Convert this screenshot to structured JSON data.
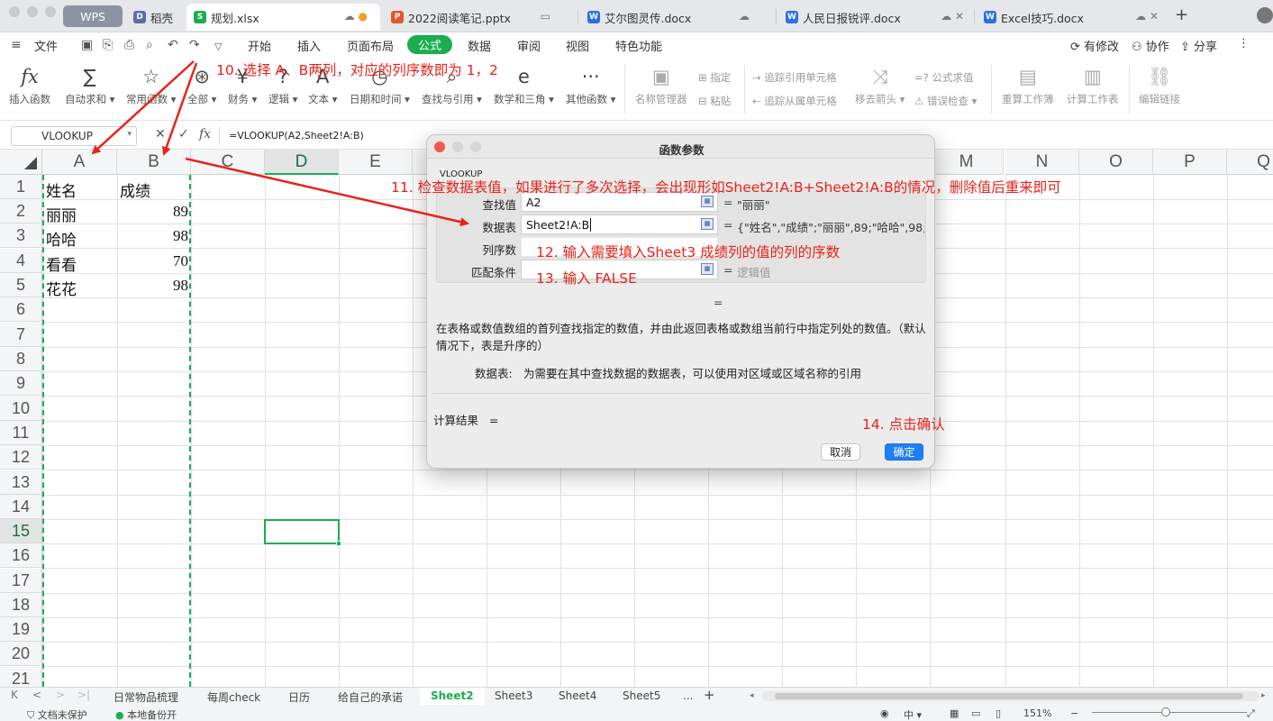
{
  "tabs": [
    {
      "label": "WPS",
      "icon": "wps-home-icon"
    },
    {
      "label": "稻壳",
      "icon": "docer-icon"
    },
    {
      "label": "规划.xlsx",
      "icon": "spreadsheet-s-icon",
      "active": true
    },
    {
      "label": "2022阅读笔记.pptx",
      "icon": "presentation-p-icon"
    },
    {
      "label": "艾尔图灵传.docx",
      "icon": "document-w-icon"
    },
    {
      "label": "人民日报锐评.docx",
      "icon": "document-w-icon"
    },
    {
      "label": "Excel技巧.docx",
      "icon": "document-w-icon"
    }
  ],
  "menubar": {
    "file_label": "文件",
    "items": [
      "开始",
      "插入",
      "页面布局",
      "公式",
      "数据",
      "审阅",
      "视图",
      "特色功能"
    ],
    "active_item": "公式",
    "right": [
      "有修改",
      "协作",
      "分享"
    ]
  },
  "ribbon": {
    "buttons": [
      {
        "icon": "fx-icon",
        "glyph": "fx",
        "label": "插入函数"
      },
      {
        "icon": "sigma-icon",
        "glyph": "∑",
        "label": "自动求和"
      },
      {
        "icon": "star-icon",
        "glyph": "☆",
        "label": "常用函数"
      },
      {
        "icon": "all-functions-icon",
        "glyph": "⊛",
        "label": "全部"
      },
      {
        "icon": "finance-icon",
        "glyph": "¥",
        "label": "财务"
      },
      {
        "icon": "logic-icon",
        "glyph": "?",
        "label": "逻辑"
      },
      {
        "icon": "text-icon",
        "glyph": "A",
        "label": "文本"
      },
      {
        "icon": "datetime-icon",
        "glyph": "◷",
        "label": "日期和时间"
      },
      {
        "icon": "lookup-icon",
        "glyph": "⌕",
        "label": "查找与引用"
      },
      {
        "icon": "math-icon",
        "glyph": "e",
        "label": "数学和三角"
      },
      {
        "icon": "more-functions-icon",
        "glyph": "···",
        "label": "其他函数"
      },
      {
        "icon": "name-manager-icon",
        "glyph": "▣",
        "label": "名称管理器"
      },
      {
        "icon": "remove-arrows-icon",
        "glyph": "⤨",
        "label": "移去箭头"
      },
      {
        "icon": "recalc-workbook-icon",
        "glyph": "▤",
        "label": "重算工作簿"
      },
      {
        "icon": "calc-sheet-icon",
        "glyph": "▥",
        "label": "计算工作表"
      },
      {
        "icon": "edit-links-icon",
        "glyph": "⛓",
        "label": "编辑链接"
      }
    ],
    "small": [
      "指定",
      "粘贴",
      "追踪引用单元格",
      "追踪从属单元格",
      "公式求值",
      "错误检查"
    ]
  },
  "formula_bar": {
    "name_box": "VLOOKUP",
    "formula": "=VLOOKUP(A2,Sheet2!A:B)"
  },
  "grid": {
    "columns": [
      "A",
      "B",
      "C",
      "D",
      "E",
      "F",
      "G",
      "H",
      "I",
      "J",
      "K",
      "L",
      "M",
      "N",
      "O",
      "P",
      "Q"
    ],
    "selected_column": "D",
    "rows": [
      "1",
      "2",
      "3",
      "4",
      "5",
      "6",
      "7",
      "8",
      "9",
      "10",
      "11",
      "12",
      "13",
      "14",
      "15",
      "16",
      "17",
      "18",
      "19",
      "20",
      "21"
    ],
    "selected_row": "15",
    "cells": [
      {
        "row": 1,
        "a": "姓名",
        "b": "成绩"
      },
      {
        "row": 2,
        "a": "丽丽",
        "b": "89"
      },
      {
        "row": 3,
        "a": "哈哈",
        "b": "98"
      },
      {
        "row": 4,
        "a": "看看",
        "b": "70"
      },
      {
        "row": 5,
        "a": "花花",
        "b": "98"
      }
    ]
  },
  "sheets": {
    "tabs": [
      "日常物品梳理",
      "每周check",
      "日历",
      "给自己的承诺",
      "Sheet2",
      "Sheet3",
      "Sheet4",
      "Sheet5",
      "..."
    ],
    "active": "Sheet2"
  },
  "statusbar": {
    "doc_status": "文档未保护",
    "backup": "本地备份开",
    "zoom": "151%"
  },
  "dialog": {
    "title": "函数参数",
    "function_name": "VLOOKUP",
    "params": [
      {
        "label": "查找值",
        "value": "A2",
        "result": "\"丽丽\""
      },
      {
        "label": "数据表",
        "value": "Sheet2!A:B",
        "result": "{\"姓名\",\"成绩\";\"丽丽\",89;\"哈哈\",98;\"..."
      },
      {
        "label": "列序数",
        "value": "",
        "result": ""
      },
      {
        "label": "匹配条件",
        "value": "",
        "result": "逻辑值"
      }
    ],
    "overall_eq": "=",
    "description": "在表格或数值数组的首列查找指定的数值，并由此返回表格或数组当前行中指定列处的数值。（默认情况下，表是升序的）",
    "arg_name": "数据表:",
    "arg_desc": "为需要在其中查找数据的数据表，可以使用对区域或区域名称的引用",
    "result_label": "计算结果",
    "result_eq": "=",
    "cancel_label": "取消",
    "ok_label": "确定"
  },
  "annotations": {
    "step10": "10. 选择 A、B两列，对应的列序数即为 1，2",
    "step11": "11. 检查数据表值，如果进行了多次选择，会出现形如Sheet2!A:B+Sheet2!A:B的情况，删除值后重来即可",
    "step12": "12. 输入需要填入Sheet3 成绩列的值的列的序数",
    "step13": "13. 输入 FALSE",
    "step14": "14. 点击确认"
  },
  "colors": {
    "accent": "#1aad51",
    "annotation": "#e8231a",
    "ok_button": "#1f7ff5"
  }
}
